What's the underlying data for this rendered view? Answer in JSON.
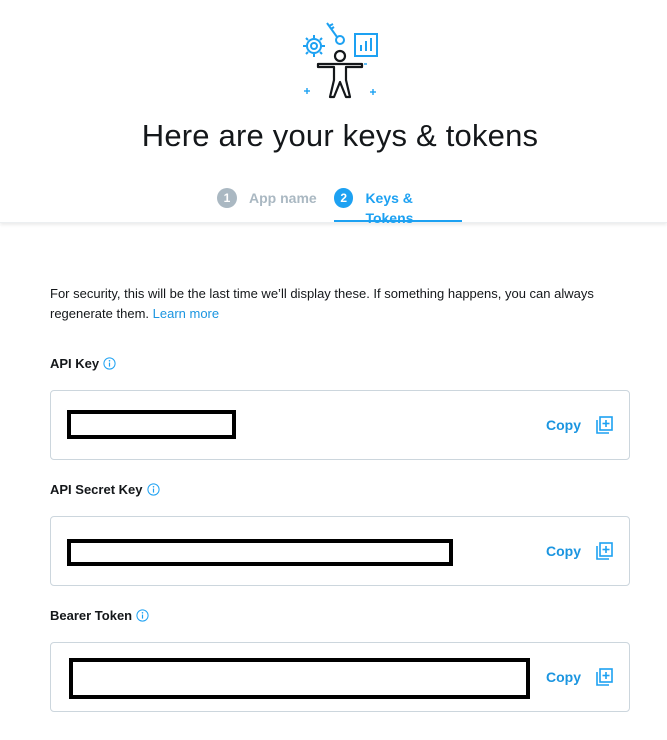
{
  "header": {
    "title": "Here are your keys & tokens",
    "steps": [
      {
        "number": "1",
        "label": "App name"
      },
      {
        "number": "2",
        "label": "Keys & Tokens"
      }
    ]
  },
  "intro": {
    "text": "For security, this will be the last time we’ll display these. If something happens, you can always regenerate them.",
    "link": "Learn more"
  },
  "fields": [
    {
      "label": "API Key",
      "copy_label": "Copy"
    },
    {
      "label": "API Secret Key",
      "copy_label": "Copy"
    },
    {
      "label": "Bearer Token",
      "copy_label": "Copy"
    }
  ],
  "colors": {
    "accent": "#1da1f2",
    "link": "#1b95e0",
    "inactive_step": "#aab8c2",
    "text": "#14171a",
    "border": "#ccd6dd"
  }
}
